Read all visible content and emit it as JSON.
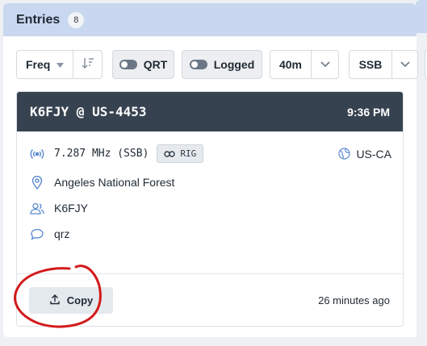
{
  "header": {
    "title": "Entries",
    "count": "8"
  },
  "toolbar": {
    "sort_label": "Freq",
    "qrt_label": "QRT",
    "logged_label": "Logged",
    "band_label": "40m",
    "mode_label": "SSB"
  },
  "card": {
    "callsign_ref": "K6FJY @ US-4453",
    "time": "9:36 PM",
    "frequency": "7.287 MHz (SSB)",
    "rig_tag": "RIG",
    "location_code": "US-CA",
    "park_name": "Angeles National Forest",
    "activator": "K6FJY",
    "comment": "qrz",
    "copy_label": "Copy",
    "spotted_ago": "26 minutes ago"
  },
  "colors": {
    "header_bg": "#c9d8f0",
    "card_head_bg": "#374251",
    "accent_icon": "#5b8ad0",
    "annotation": "#d31a1a"
  }
}
